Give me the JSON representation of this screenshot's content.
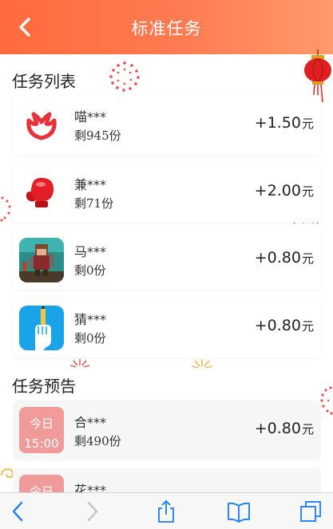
{
  "header": {
    "title": "标准任务",
    "back_icon": "chevron-left-icon"
  },
  "sections": {
    "list_title": "任务列表",
    "preview_title": "任务预告"
  },
  "tasks": [
    {
      "name": "喵***",
      "remaining": "剩945份",
      "amount": "+1.50",
      "unit": "元",
      "icon": "red-flower-logo-icon"
    },
    {
      "name": "兼***",
      "remaining": "剩71份",
      "amount": "+2.00",
      "unit": "元",
      "icon": "boxing-glove-icon"
    },
    {
      "name": "马***",
      "remaining": "剩0份",
      "amount": "+0.80",
      "unit": "元",
      "icon": "pixel-game-character-icon"
    },
    {
      "name": "猜***",
      "remaining": "剩0份",
      "amount": "+0.80",
      "unit": "元",
      "icon": "hand-pencil-icon"
    }
  ],
  "previews": [
    {
      "badge_day": "今日",
      "badge_time": "15:00",
      "name": "合***",
      "remaining": "剩490份",
      "amount": "+0.80",
      "unit": "元"
    },
    {
      "badge_day": "今日",
      "badge_time": "",
      "name": "花***",
      "remaining": "",
      "amount": "",
      "unit": ""
    }
  ],
  "toolbar": {
    "icons": [
      "back-arrow-icon",
      "forward-arrow-icon",
      "share-icon",
      "bookmarks-icon",
      "tabs-icon"
    ]
  },
  "colors": {
    "header_start": "#ff6a3d",
    "header_end": "#ff9a6a",
    "badge": "#f09a9a",
    "toolbar_blue": "#1a7cf5"
  }
}
